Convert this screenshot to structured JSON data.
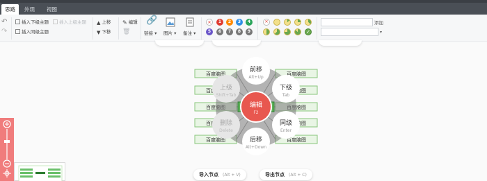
{
  "tabs": [
    {
      "label": "思路"
    },
    {
      "label": "外观"
    },
    {
      "label": "视图"
    }
  ],
  "toolbar": {
    "insert_child": "插入下级主题",
    "insert_parent": "插入上级主题",
    "insert_sibling": "插入同级主题",
    "move_up": "上移",
    "move_down": "下移",
    "edit": "编辑",
    "link": "链接",
    "image": "图片",
    "note": "备注",
    "add": "添加",
    "priorities": [
      "1",
      "2",
      "3",
      "4",
      "5",
      "6",
      "7",
      "8",
      "9"
    ],
    "priority_colors": [
      "#e03c31",
      "#ff8a00",
      "#2f8fe6",
      "#2aa55a",
      "#6a56c9",
      "#777777",
      "#777777",
      "#777777",
      "#777777"
    ],
    "progress_levels": [
      "none",
      "1/8",
      "2/8",
      "3/8",
      "4/8",
      "5/8",
      "6/8",
      "7/8",
      "done"
    ]
  },
  "canvas": {
    "center": {
      "label": "编辑",
      "shortcut": "F2"
    },
    "actions": [
      {
        "label": "前移",
        "shortcut": "Alt+Up",
        "enabled": true
      },
      {
        "label": "下级",
        "shortcut": "Tab",
        "enabled": true
      },
      {
        "label": "同级",
        "shortcut": "Enter",
        "enabled": true
      },
      {
        "label": "后移",
        "shortcut": "Alt+Down",
        "enabled": true
      },
      {
        "label": "删除",
        "shortcut": "Delete",
        "enabled": false
      },
      {
        "label": "上级",
        "shortcut": "Shift+Tab",
        "enabled": false
      }
    ],
    "node_label": "百度脑图",
    "import_label": "导入节点",
    "import_shortcut": "(Alt + V)",
    "export_label": "导出节点",
    "export_shortcut": "(Alt + C)"
  },
  "colors": {
    "accent": "#e8574f",
    "node_border": "#88c57b",
    "node_fill": "#e9f5e5",
    "zoom": "#f07c7c"
  }
}
